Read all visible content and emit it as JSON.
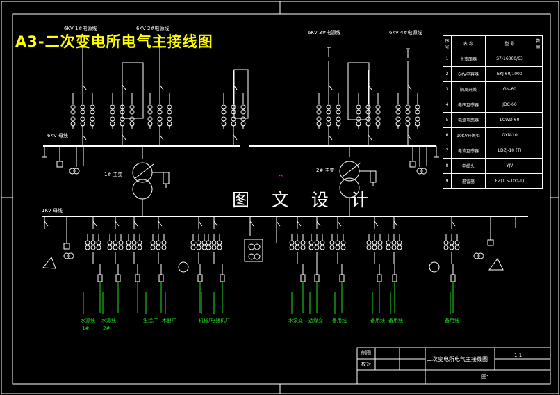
{
  "title": "A3-二次变电所电气主接线图",
  "watermark": "图 文 设 计",
  "labels": {
    "incoming_1": "6KV 1#电源线",
    "incoming_2": "6KV 2#电源线",
    "incoming_3": "6KV 3#电源线",
    "incoming_4": "6KV 4#电源线",
    "bus_6kv": "6KV 母线",
    "bus_1kv": "1KV 母线",
    "transformer_1": "1# 主变",
    "transformer_2": "2# 主变"
  },
  "feeders": [
    {
      "name": "水源线",
      "sub": "1#"
    },
    {
      "name": "水源线",
      "sub": "2#"
    },
    {
      "name": "生活厂"
    },
    {
      "name": "木器厂"
    },
    {
      "name": "机械厂"
    },
    {
      "name": "电器机厂"
    },
    {
      "name": "水泵变"
    },
    {
      "name": "选煤变"
    },
    {
      "name": "备用线"
    },
    {
      "name": "备用线"
    },
    {
      "name": "备用线"
    },
    {
      "name": "备用线"
    }
  ],
  "bom": {
    "headers": [
      "序号",
      "名 称",
      "型 号",
      "数量"
    ],
    "rows": [
      [
        "1",
        "主变压器",
        "S7-16000/63",
        ""
      ],
      [
        "2",
        "6KV电容器",
        "SKJ-60/1000",
        ""
      ],
      [
        "3",
        "隔离开关",
        "GN-60",
        ""
      ],
      [
        "4",
        "电压互感器",
        "JDC-60",
        ""
      ],
      [
        "5",
        "电流互感器",
        "LCWD-60",
        ""
      ],
      [
        "6",
        "10KV开关柜",
        "GYN-10",
        ""
      ],
      [
        "7",
        "电流互感器",
        "LDZJ-10 (T)",
        ""
      ],
      [
        "8",
        "电缆头",
        "YJV",
        ""
      ],
      [
        "9",
        "避雷器",
        "FZ(1.5-100-1)",
        ""
      ]
    ]
  },
  "title_block": {
    "drawn": "制图",
    "checked": "校对",
    "drawing_name": "二次变电所电气主接线图",
    "scale": "1:1",
    "sheet": "图1"
  }
}
